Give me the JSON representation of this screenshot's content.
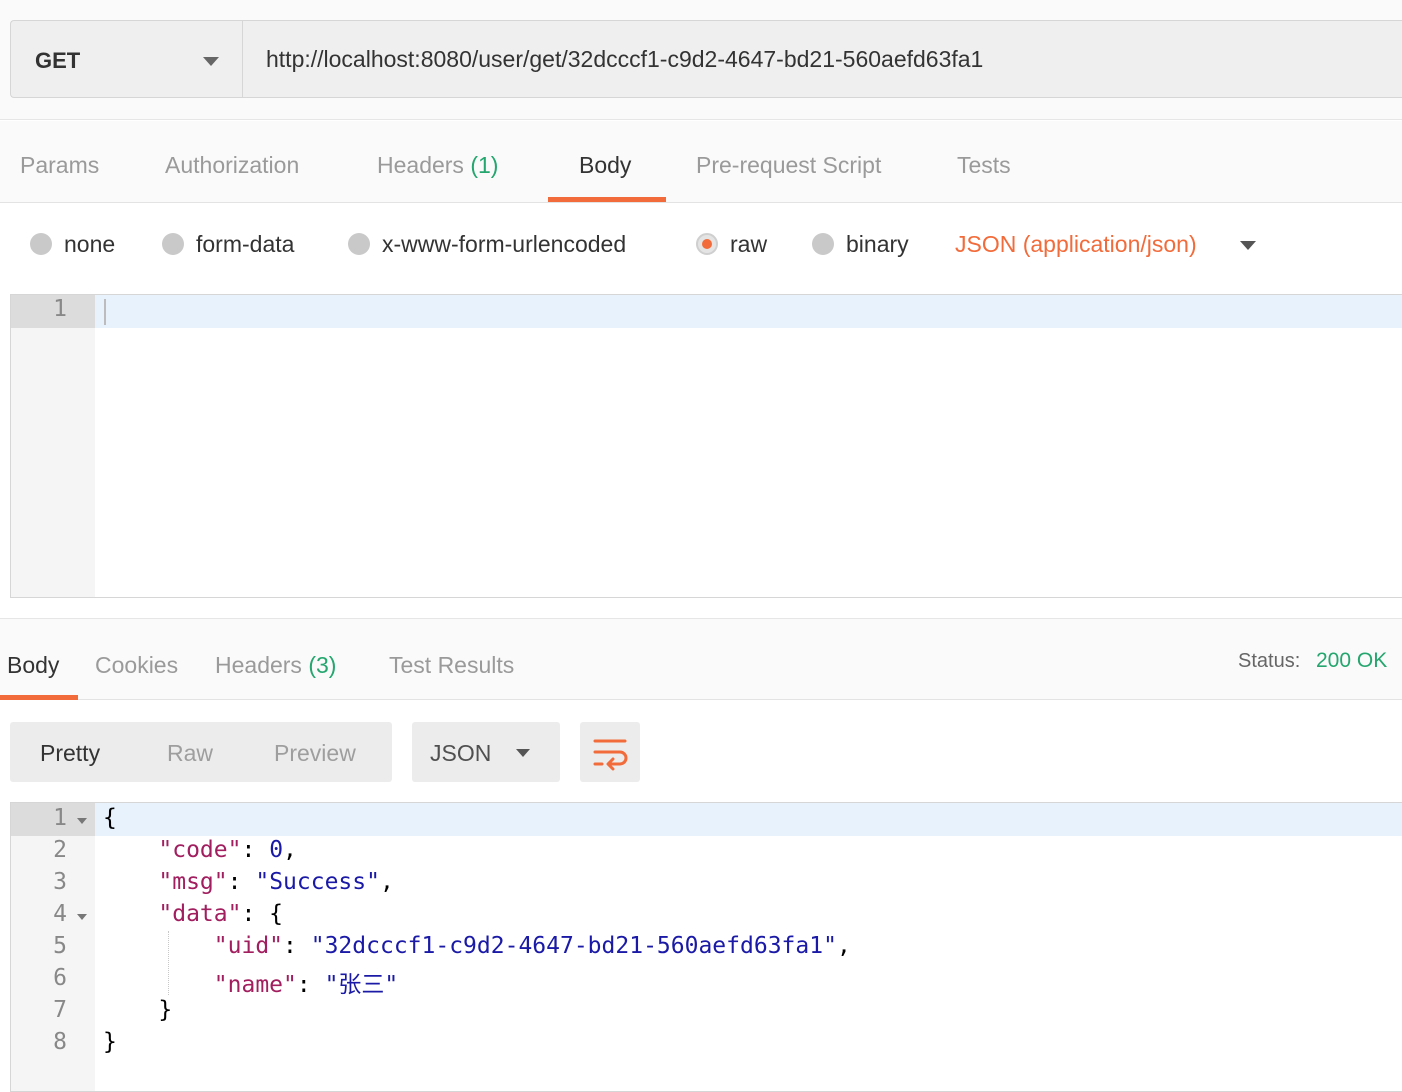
{
  "request": {
    "method": "GET",
    "url": "http://localhost:8080/user/get/32dcccf1-c9d2-4647-bd21-560aefd63fa1"
  },
  "request_tabs": [
    {
      "label": "Params",
      "count": ""
    },
    {
      "label": "Authorization",
      "count": ""
    },
    {
      "label": "Headers",
      "count": "(1)"
    },
    {
      "label": "Body",
      "count": ""
    },
    {
      "label": "Pre-request Script",
      "count": ""
    },
    {
      "label": "Tests",
      "count": ""
    }
  ],
  "body_types": [
    {
      "label": "none",
      "selected": false
    },
    {
      "label": "form-data",
      "selected": false
    },
    {
      "label": "x-www-form-urlencoded",
      "selected": false
    },
    {
      "label": "raw",
      "selected": true
    },
    {
      "label": "binary",
      "selected": false
    }
  ],
  "body_language": "JSON (application/json)",
  "request_editor": {
    "line_numbers": [
      "1"
    ],
    "content": ""
  },
  "response_tabs": [
    {
      "label": "Body",
      "count": ""
    },
    {
      "label": "Cookies",
      "count": ""
    },
    {
      "label": "Headers",
      "count": "(3)"
    },
    {
      "label": "Test Results",
      "count": ""
    }
  ],
  "status": {
    "label": "Status:",
    "value": "200 OK"
  },
  "response_view": {
    "modes": [
      "Pretty",
      "Raw",
      "Preview"
    ],
    "active_mode": "Pretty",
    "format": "JSON"
  },
  "response_editor": {
    "line_numbers": [
      "1",
      "2",
      "3",
      "4",
      "5",
      "6",
      "7",
      "8"
    ],
    "lines": [
      {
        "indent": "",
        "tokens": [
          [
            "p",
            "{"
          ]
        ]
      },
      {
        "indent": "    ",
        "tokens": [
          [
            "k",
            "\"code\""
          ],
          [
            "p",
            ": "
          ],
          [
            "n",
            "0"
          ],
          [
            "p",
            ","
          ]
        ]
      },
      {
        "indent": "    ",
        "tokens": [
          [
            "k",
            "\"msg\""
          ],
          [
            "p",
            ": "
          ],
          [
            "s",
            "\"Success\""
          ],
          [
            "p",
            ","
          ]
        ]
      },
      {
        "indent": "    ",
        "tokens": [
          [
            "k",
            "\"data\""
          ],
          [
            "p",
            ": {"
          ]
        ]
      },
      {
        "indent": "        ",
        "tokens": [
          [
            "k",
            "\"uid\""
          ],
          [
            "p",
            ": "
          ],
          [
            "s",
            "\"32dcccf1-c9d2-4647-bd21-560aefd63fa1\""
          ],
          [
            "p",
            ","
          ]
        ]
      },
      {
        "indent": "        ",
        "tokens": [
          [
            "k",
            "\"name\""
          ],
          [
            "p",
            ": "
          ],
          [
            "s",
            "\"张三\""
          ]
        ]
      },
      {
        "indent": "    ",
        "tokens": [
          [
            "p",
            "}"
          ]
        ]
      },
      {
        "indent": "",
        "tokens": [
          [
            "p",
            "}"
          ]
        ]
      }
    ]
  },
  "colors": {
    "accent": "#f26b3a",
    "success": "#25a66f",
    "json_key": "#a11e5f",
    "json_string": "#1a1aa6"
  },
  "icons": {
    "method_dropdown": "chevron-down-icon",
    "wrap": "wrap-lines-icon",
    "fold": "fold-caret-icon"
  }
}
